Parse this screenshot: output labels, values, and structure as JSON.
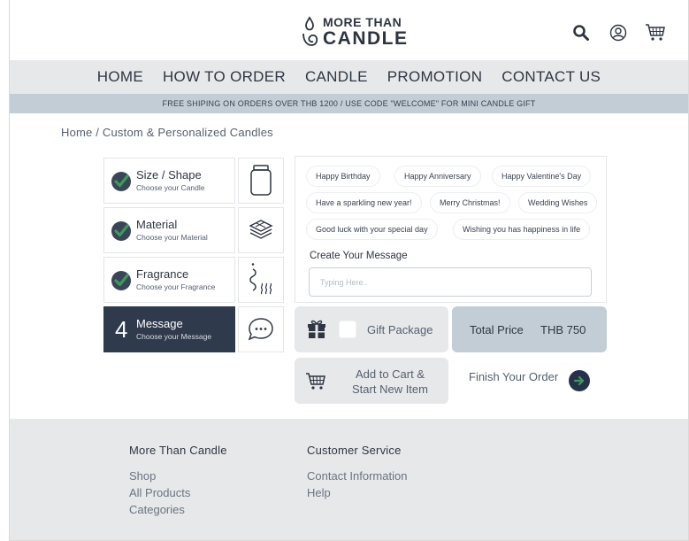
{
  "header": {
    "logo_line1": "MORE THAN",
    "logo_line2": "CANDLE",
    "icons": [
      "search-icon",
      "account-icon",
      "cart-icon"
    ]
  },
  "nav": {
    "items": [
      {
        "label": "HOME"
      },
      {
        "label": "HOW TO ORDER"
      },
      {
        "label": "CANDLE"
      },
      {
        "label": "PROMOTION"
      },
      {
        "label": "CONTACT US"
      }
    ]
  },
  "banner": {
    "text": "FREE SHIPING ON ORDERS OVER THB 1200 / USE CODE \"WELCOME\" FOR MINI CANDLE GIFT"
  },
  "breadcrumb": {
    "text": "Home / Custom & Personalized Candles"
  },
  "steps": [
    {
      "title": "Size / Shape",
      "subtitle": "Choose your Candle",
      "status": "done",
      "icon": "jar-icon"
    },
    {
      "title": "Material",
      "subtitle": "Choose your Material",
      "status": "done",
      "icon": "layers-icon"
    },
    {
      "title": "Fragrance",
      "subtitle": "Choose your Fragrance",
      "status": "done",
      "icon": "scent-icon"
    },
    {
      "title": "Message",
      "subtitle": "Choose your Message",
      "status": "active",
      "number": "4",
      "icon": "chat-bubble-icon"
    }
  ],
  "message": {
    "suggestions": [
      "Happy Birthday",
      "Happy Anniversary",
      "Happy Valentine's Day",
      "Have a sparkling new year!",
      "Merry Christmas!",
      "Wedding Wishes",
      "Good luck with your special day",
      "Wishing you has happiness in life"
    ],
    "create_label": "Create Your Message",
    "input_placeholder": "Typing Here..",
    "input_value": ""
  },
  "gift": {
    "label": "Gift Package",
    "checked": false
  },
  "total": {
    "label": "Total Price",
    "value": "THB 750"
  },
  "cart": {
    "line1": "Add to Cart &",
    "line2": "Start New Item"
  },
  "finish": {
    "label": "Finish Your Order"
  },
  "footer": {
    "col1": {
      "heading": "More Than Candle",
      "links": [
        "Shop",
        "All Products",
        "Categories"
      ]
    },
    "col2": {
      "heading": "Customer Service",
      "links": [
        "Contact Information",
        "Help"
      ]
    }
  },
  "colors": {
    "dark_navy": "#2f3a4c",
    "banner_blue": "#c2cdd6",
    "light_gray": "#e7e8ea",
    "check_green": "#3b9c57"
  }
}
